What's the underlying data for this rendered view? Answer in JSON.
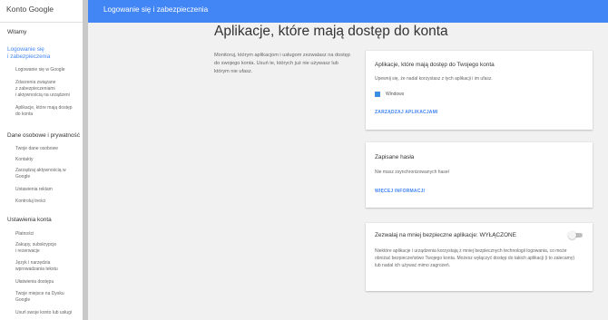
{
  "app": {
    "title": "Konto Google"
  },
  "topbar": {
    "title": "Logowanie się i zabezpieczenia"
  },
  "sidebar": {
    "welcome": "Witamy",
    "active_section": [
      "Logowanie się",
      "i zabezpieczenia"
    ],
    "security_items": [
      [
        "Logowanie się w Google"
      ],
      [
        "Zdarzenia związane",
        "z zabezpieczeniami",
        "i aktywnością na urządzeni"
      ],
      [
        "Aplikacje, które mają dostęp",
        "do konta"
      ]
    ],
    "privacy_header": "Dane osobowe i prywatność",
    "privacy_items": [
      [
        "Twoje dane osobowe"
      ],
      [
        "Kontakty"
      ],
      [
        "Zarządzaj aktywnością w",
        "Google"
      ],
      [
        "Ustawienia reklam"
      ],
      [
        "Kontroluj treści"
      ]
    ],
    "account_header": "Ustawienia konta",
    "account_items": [
      [
        "Płatności"
      ],
      [
        "Zakupy, subskrypcje",
        "i rezerwacje"
      ],
      [
        "Język i narzędzia",
        "wprowadzania tekstu"
      ],
      [
        "Ułatwienia dostępu"
      ],
      [
        "Twoje miejsce na Dysku",
        "Google"
      ],
      [
        "Usuń swoje konto lub usługi"
      ]
    ]
  },
  "main": {
    "title": "Aplikacje, które mają dostęp do konta",
    "intro": "Monitoruj, którym aplikacjom i usługom zezwalasz na dostęp do swojego konta. Usuń te, których już nie używasz lub którym nie ufasz."
  },
  "cards": {
    "apps": {
      "title": "Aplikacje, które mają dostęp do Twojego konta",
      "text": "Upewnij się, że nadal korzystasz z tych aplikacji i im ufasz.",
      "app_name": "Windows",
      "icon": "windows-icon",
      "link": "ZARZĄDZAJ APLIKACJAMI"
    },
    "passwords": {
      "title": "Zapisane hasła",
      "text": "Nie masz zsynchronizowanych haseł",
      "link": "WIĘCEJ INFORMACJI"
    },
    "less_secure": {
      "title": "Zezwalaj na mniej bezpieczne aplikacje: WYŁĄCZONE",
      "text": "Niektóre aplikacje i urządzenia korzystają z mniej bezpiecznych technologii logowania, co może obniżać bezpieczeństwo Twojego konta. Możesz wyłączyć dostęp do takich aplikacji (i to zalecamy) lub nadal ich używać mimo zagrożeń.",
      "toggle_on": false
    }
  },
  "colors": {
    "accent": "#4285f4",
    "background": "#f1f1f1"
  }
}
